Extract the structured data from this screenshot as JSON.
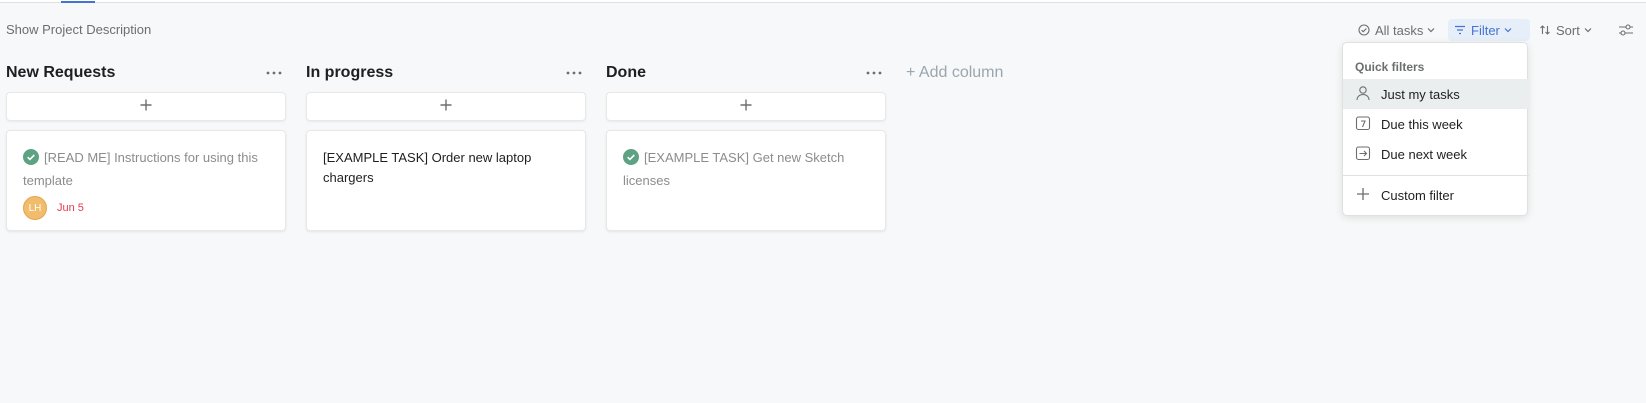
{
  "header": {
    "show_description": "Show Project Description"
  },
  "toolbar": {
    "all_tasks_label": "All tasks",
    "filter_label": "Filter",
    "sort_label": "Sort"
  },
  "columns": [
    {
      "title": "New Requests",
      "cards": [
        {
          "title": "[READ ME] Instructions for using this template",
          "completed": true,
          "assignee_initials": "LH",
          "due": "Jun 5"
        }
      ]
    },
    {
      "title": "In progress",
      "cards": [
        {
          "title": "[EXAMPLE TASK] Order new laptop chargers",
          "completed": false
        }
      ]
    },
    {
      "title": "Done",
      "cards": [
        {
          "title": "[EXAMPLE TASK] Get new Sketch licenses",
          "completed": true
        }
      ]
    }
  ],
  "add_column_label": "+ Add column",
  "filter_menu": {
    "heading": "Quick filters",
    "items": [
      {
        "label": "Just my tasks",
        "icon": "user-icon"
      },
      {
        "label": "Due this week",
        "icon": "calendar-seven-icon"
      },
      {
        "label": "Due next week",
        "icon": "calendar-arrow-icon"
      }
    ],
    "custom_label": "Custom filter"
  },
  "colors": {
    "accent": "#4573d2",
    "complete_check": "#5da283",
    "overdue": "#e8384f",
    "avatar_bg": "#f1bd6c"
  }
}
